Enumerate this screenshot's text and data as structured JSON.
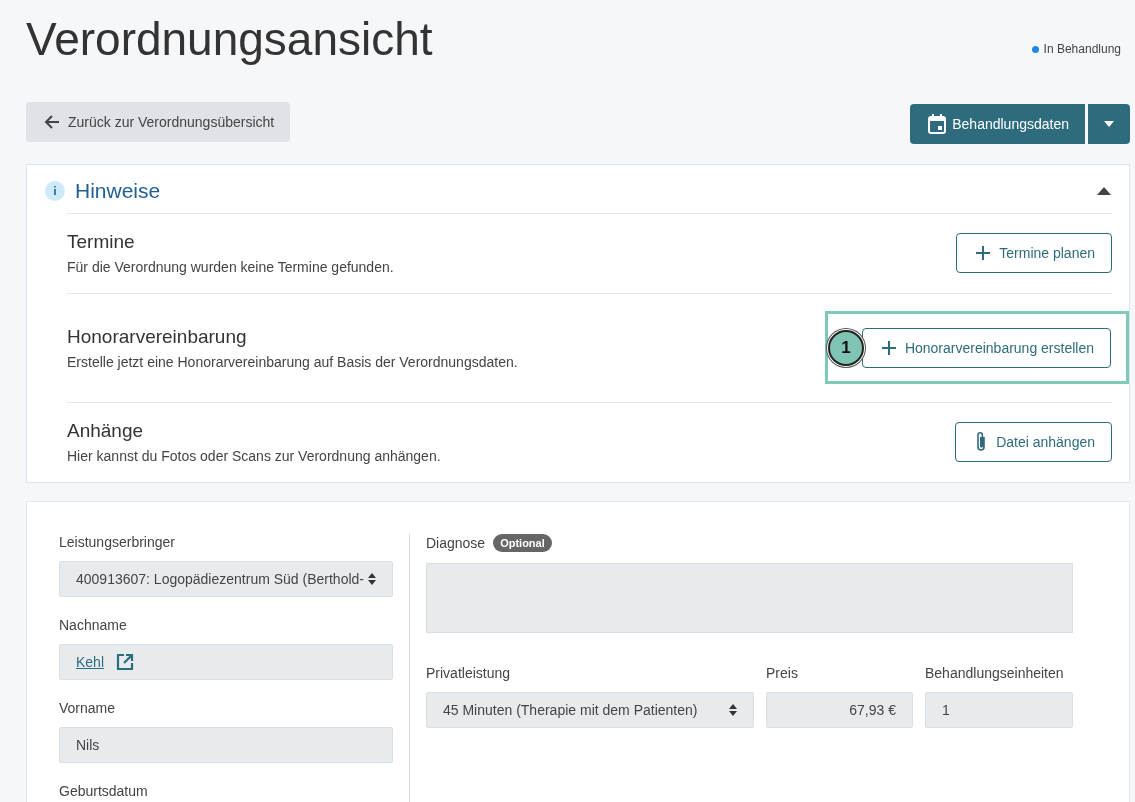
{
  "page": {
    "title": "Verordnungsansicht",
    "status": {
      "label": "In Behandlung",
      "color": "#1e88e5"
    }
  },
  "back_button": {
    "label": "Zurück zur Verordnungsübersicht"
  },
  "primary_action": {
    "label": "Behandlungsdaten"
  },
  "notices": {
    "title": "Hinweise",
    "expanded": true,
    "items": [
      {
        "kind": "appointments",
        "title": "Termine",
        "description": "Für die Verordnung wurden keine Termine gefunden.",
        "button": "Termine planen",
        "highlighted": false
      },
      {
        "kind": "fee",
        "title": "Honorarvereinbarung",
        "description": "Erstelle jetzt eine Honorarvereinbarung auf Basis der Verordnungsdaten.",
        "button": "Honorarvereinbarung erstellen",
        "highlighted": true,
        "step": "1"
      },
      {
        "kind": "attachment",
        "title": "Anhänge",
        "description": "Hier kannst du Fotos oder Scans zur Verordnung anhängen.",
        "button": "Datei anhängen",
        "highlighted": false
      }
    ]
  },
  "form": {
    "left": [
      {
        "kind": "select",
        "label": "Leistungserbringer",
        "value": "400913607: Logopädiezentrum Süd (Berthold-"
      },
      {
        "kind": "link",
        "label": "Nachname",
        "value": "Kehl"
      },
      {
        "kind": "text",
        "label": "Vorname",
        "value": "Nils"
      },
      {
        "kind": "label",
        "label": "Geburtsdatum"
      }
    ],
    "diagnosis": {
      "label": "Diagnose",
      "badge": "Optional"
    },
    "service": {
      "label": "Privatleistung",
      "value": "45 Minuten (Therapie mit dem Patienten)"
    },
    "price": {
      "label": "Preis",
      "value": "67,93 €"
    },
    "units": {
      "label": "Behandlungseinheiten",
      "value": "1"
    }
  }
}
